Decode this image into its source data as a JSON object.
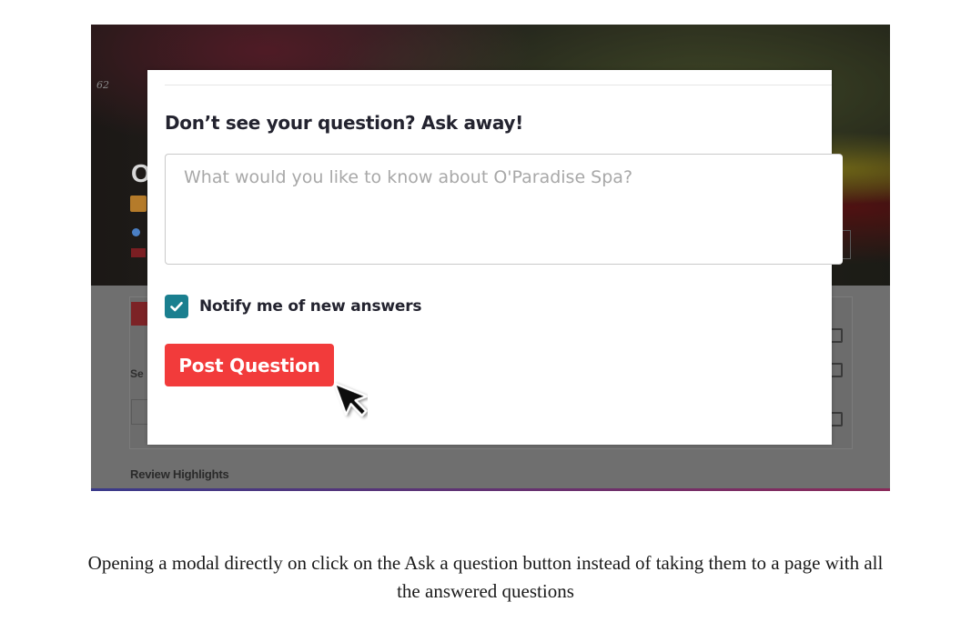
{
  "screenshot": {
    "hero": {
      "photo_number": "62",
      "title_initial": "O"
    },
    "background": {
      "search_label_partial": "Se",
      "review_highlights": "Review Highlights"
    },
    "modal": {
      "title": "Don’t see your question? Ask away!",
      "question_input": {
        "placeholder": "What would you like to know about O'Paradise Spa?",
        "value": ""
      },
      "notify": {
        "label": "Notify me of new answers",
        "checked": true,
        "checkbox_color": "#1a7f8f"
      },
      "post_button": {
        "label": "Post Question",
        "color": "#f23b3b"
      },
      "cursor_icon": "arrow-pointer-icon"
    }
  },
  "caption": {
    "line1": "Opening a modal directly on click on the Ask a question button instead of taking them to a page with all",
    "line2": "the answered questions"
  }
}
